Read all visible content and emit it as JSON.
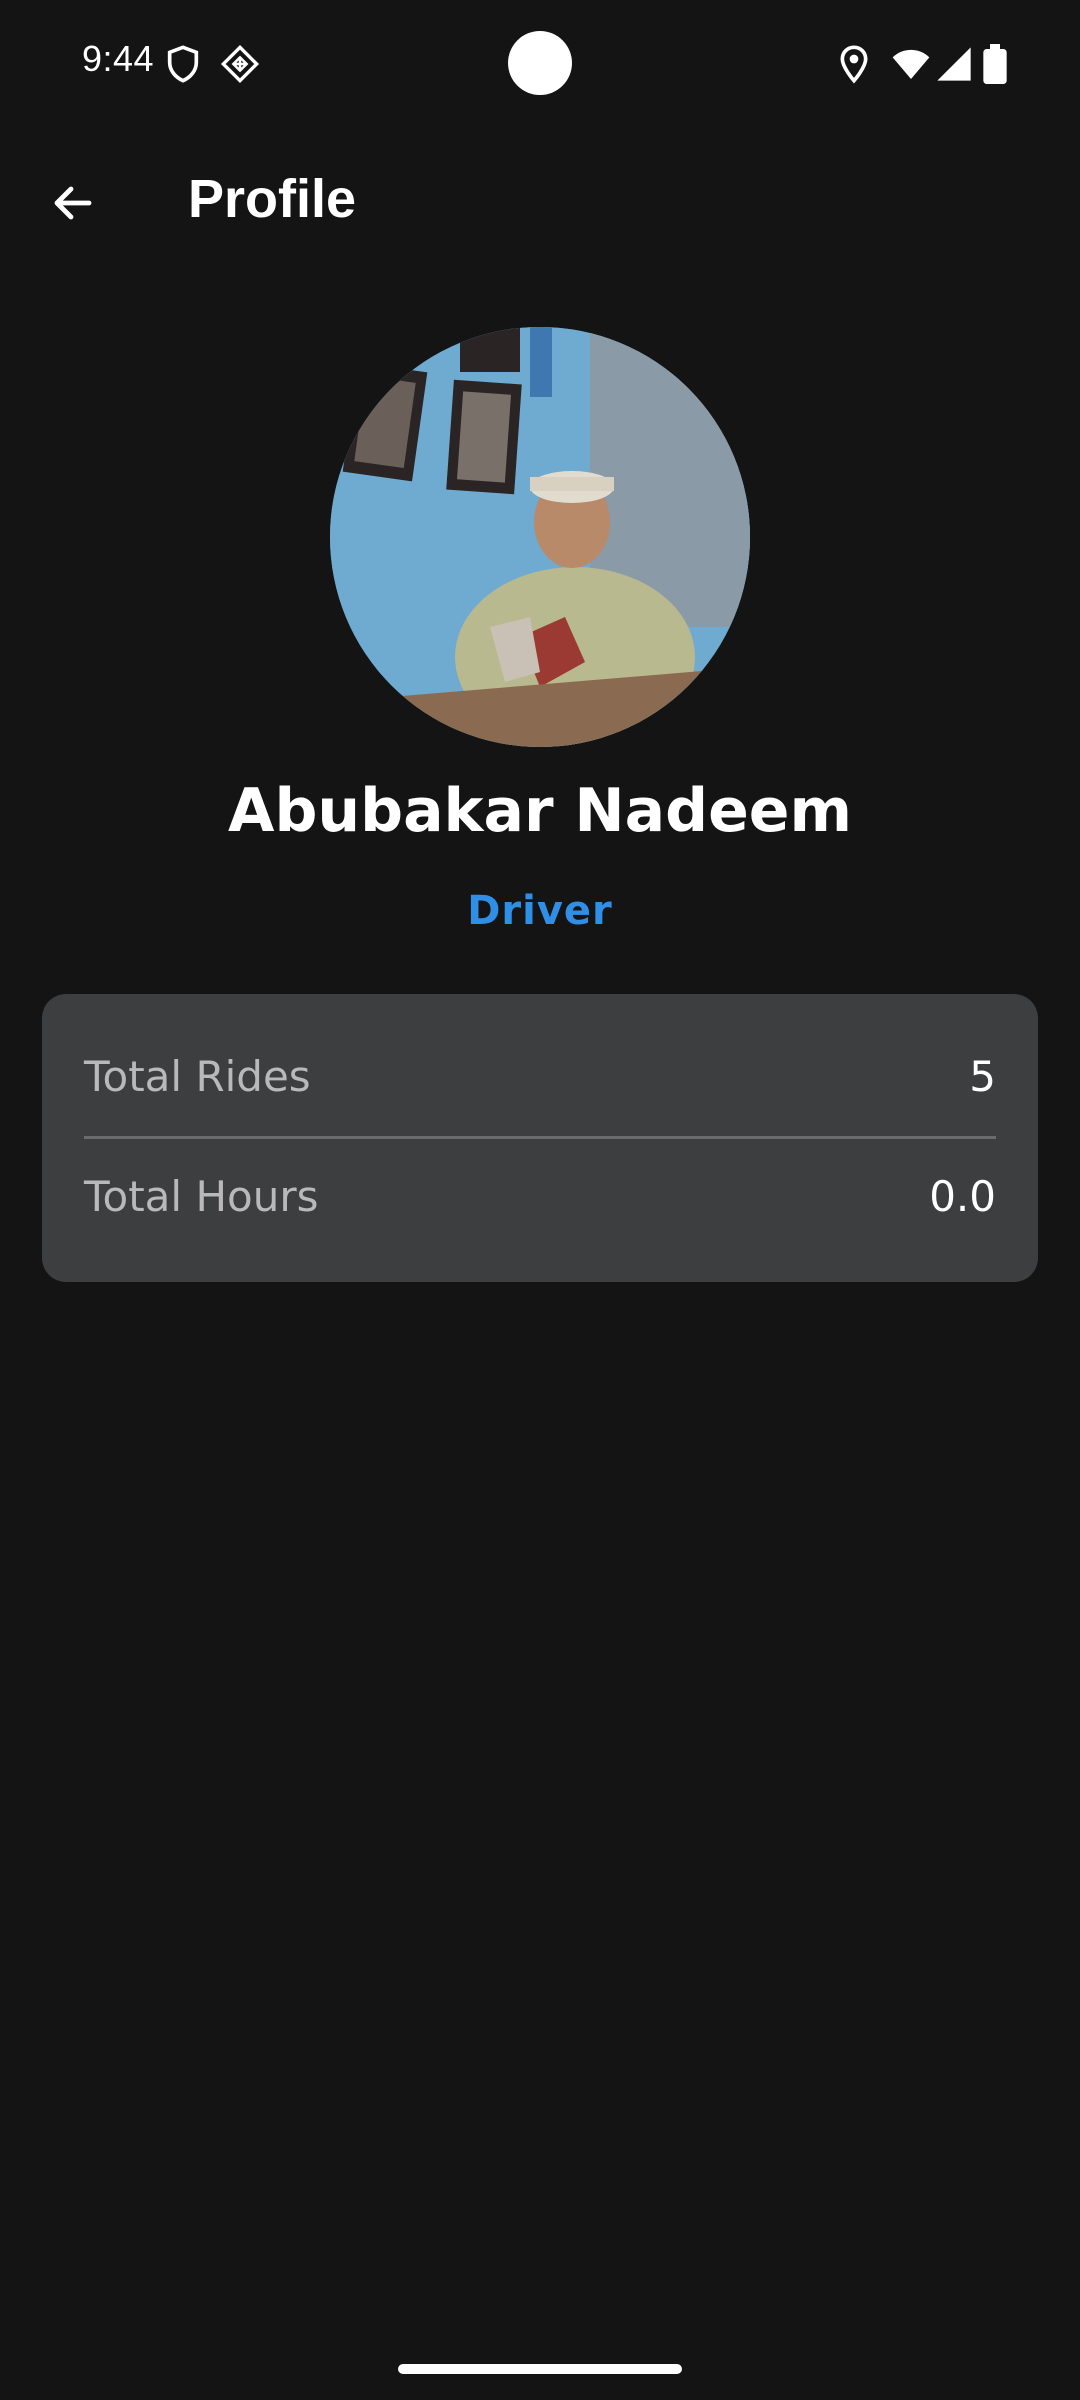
{
  "status_bar": {
    "time": "9:44",
    "left_icons": [
      "shield-icon",
      "diamond-grid-icon"
    ],
    "right_icons": [
      "location-icon",
      "wifi-icon",
      "signal-icon",
      "battery-icon"
    ]
  },
  "app_bar": {
    "title": "Profile",
    "back_icon": "arrow-left-icon"
  },
  "profile": {
    "name": "Abubakar Nadeem",
    "role": "Driver",
    "role_color": "#2f8fe6"
  },
  "stats": {
    "total_rides_label": "Total Rides",
    "total_rides_value": "5",
    "total_hours_label": "Total Hours",
    "total_hours_value": "0.0"
  },
  "colors": {
    "background": "#141414",
    "card": "#3d3e40",
    "accent": "#2f8fe6"
  }
}
